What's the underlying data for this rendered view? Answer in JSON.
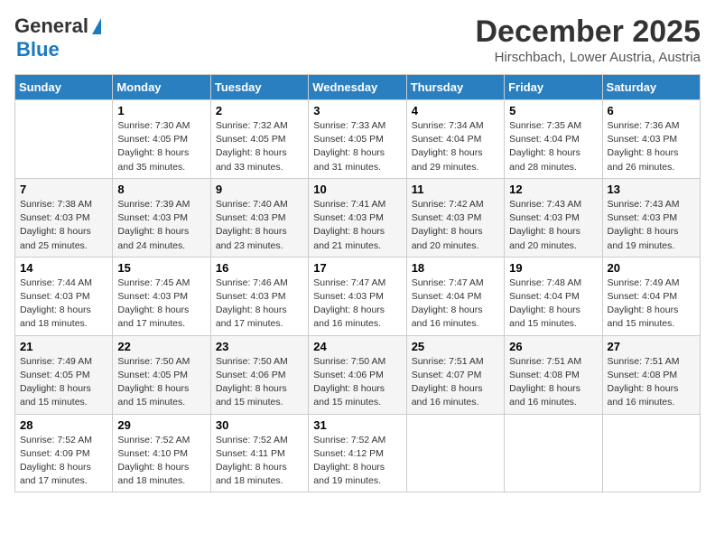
{
  "logo": {
    "line1": "General",
    "line2": "Blue"
  },
  "header": {
    "month": "December 2025",
    "location": "Hirschbach, Lower Austria, Austria"
  },
  "weekdays": [
    "Sunday",
    "Monday",
    "Tuesday",
    "Wednesday",
    "Thursday",
    "Friday",
    "Saturday"
  ],
  "weeks": [
    [
      {
        "day": "",
        "info": ""
      },
      {
        "day": "1",
        "info": "Sunrise: 7:30 AM\nSunset: 4:05 PM\nDaylight: 8 hours\nand 35 minutes."
      },
      {
        "day": "2",
        "info": "Sunrise: 7:32 AM\nSunset: 4:05 PM\nDaylight: 8 hours\nand 33 minutes."
      },
      {
        "day": "3",
        "info": "Sunrise: 7:33 AM\nSunset: 4:05 PM\nDaylight: 8 hours\nand 31 minutes."
      },
      {
        "day": "4",
        "info": "Sunrise: 7:34 AM\nSunset: 4:04 PM\nDaylight: 8 hours\nand 29 minutes."
      },
      {
        "day": "5",
        "info": "Sunrise: 7:35 AM\nSunset: 4:04 PM\nDaylight: 8 hours\nand 28 minutes."
      },
      {
        "day": "6",
        "info": "Sunrise: 7:36 AM\nSunset: 4:03 PM\nDaylight: 8 hours\nand 26 minutes."
      }
    ],
    [
      {
        "day": "7",
        "info": "Sunrise: 7:38 AM\nSunset: 4:03 PM\nDaylight: 8 hours\nand 25 minutes."
      },
      {
        "day": "8",
        "info": "Sunrise: 7:39 AM\nSunset: 4:03 PM\nDaylight: 8 hours\nand 24 minutes."
      },
      {
        "day": "9",
        "info": "Sunrise: 7:40 AM\nSunset: 4:03 PM\nDaylight: 8 hours\nand 23 minutes."
      },
      {
        "day": "10",
        "info": "Sunrise: 7:41 AM\nSunset: 4:03 PM\nDaylight: 8 hours\nand 21 minutes."
      },
      {
        "day": "11",
        "info": "Sunrise: 7:42 AM\nSunset: 4:03 PM\nDaylight: 8 hours\nand 20 minutes."
      },
      {
        "day": "12",
        "info": "Sunrise: 7:43 AM\nSunset: 4:03 PM\nDaylight: 8 hours\nand 20 minutes."
      },
      {
        "day": "13",
        "info": "Sunrise: 7:43 AM\nSunset: 4:03 PM\nDaylight: 8 hours\nand 19 minutes."
      }
    ],
    [
      {
        "day": "14",
        "info": "Sunrise: 7:44 AM\nSunset: 4:03 PM\nDaylight: 8 hours\nand 18 minutes."
      },
      {
        "day": "15",
        "info": "Sunrise: 7:45 AM\nSunset: 4:03 PM\nDaylight: 8 hours\nand 17 minutes."
      },
      {
        "day": "16",
        "info": "Sunrise: 7:46 AM\nSunset: 4:03 PM\nDaylight: 8 hours\nand 17 minutes."
      },
      {
        "day": "17",
        "info": "Sunrise: 7:47 AM\nSunset: 4:03 PM\nDaylight: 8 hours\nand 16 minutes."
      },
      {
        "day": "18",
        "info": "Sunrise: 7:47 AM\nSunset: 4:04 PM\nDaylight: 8 hours\nand 16 minutes."
      },
      {
        "day": "19",
        "info": "Sunrise: 7:48 AM\nSunset: 4:04 PM\nDaylight: 8 hours\nand 15 minutes."
      },
      {
        "day": "20",
        "info": "Sunrise: 7:49 AM\nSunset: 4:04 PM\nDaylight: 8 hours\nand 15 minutes."
      }
    ],
    [
      {
        "day": "21",
        "info": "Sunrise: 7:49 AM\nSunset: 4:05 PM\nDaylight: 8 hours\nand 15 minutes."
      },
      {
        "day": "22",
        "info": "Sunrise: 7:50 AM\nSunset: 4:05 PM\nDaylight: 8 hours\nand 15 minutes."
      },
      {
        "day": "23",
        "info": "Sunrise: 7:50 AM\nSunset: 4:06 PM\nDaylight: 8 hours\nand 15 minutes."
      },
      {
        "day": "24",
        "info": "Sunrise: 7:50 AM\nSunset: 4:06 PM\nDaylight: 8 hours\nand 15 minutes."
      },
      {
        "day": "25",
        "info": "Sunrise: 7:51 AM\nSunset: 4:07 PM\nDaylight: 8 hours\nand 16 minutes."
      },
      {
        "day": "26",
        "info": "Sunrise: 7:51 AM\nSunset: 4:08 PM\nDaylight: 8 hours\nand 16 minutes."
      },
      {
        "day": "27",
        "info": "Sunrise: 7:51 AM\nSunset: 4:08 PM\nDaylight: 8 hours\nand 16 minutes."
      }
    ],
    [
      {
        "day": "28",
        "info": "Sunrise: 7:52 AM\nSunset: 4:09 PM\nDaylight: 8 hours\nand 17 minutes."
      },
      {
        "day": "29",
        "info": "Sunrise: 7:52 AM\nSunset: 4:10 PM\nDaylight: 8 hours\nand 18 minutes."
      },
      {
        "day": "30",
        "info": "Sunrise: 7:52 AM\nSunset: 4:11 PM\nDaylight: 8 hours\nand 18 minutes."
      },
      {
        "day": "31",
        "info": "Sunrise: 7:52 AM\nSunset: 4:12 PM\nDaylight: 8 hours\nand 19 minutes."
      },
      {
        "day": "",
        "info": ""
      },
      {
        "day": "",
        "info": ""
      },
      {
        "day": "",
        "info": ""
      }
    ]
  ]
}
